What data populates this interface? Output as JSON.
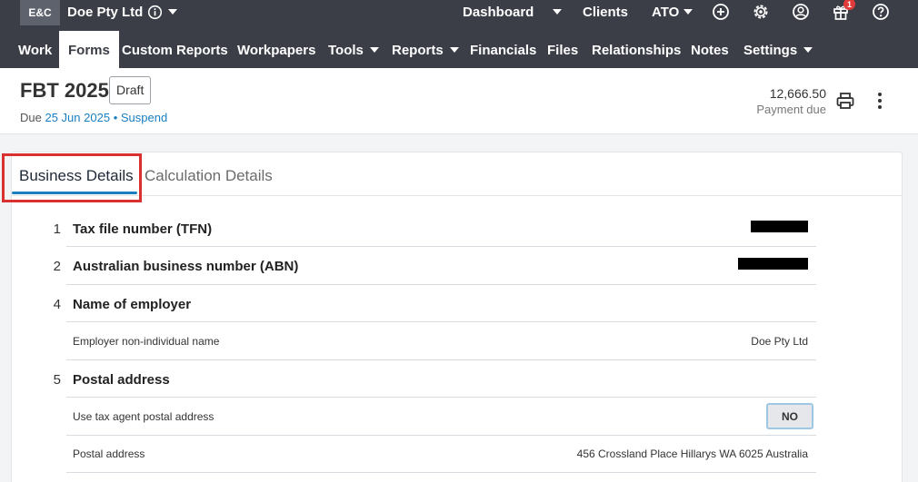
{
  "topbar": {
    "logo_text": "E&C",
    "client_name": "Doe Pty Ltd",
    "dashboard": "Dashboard",
    "clients": "Clients",
    "ato": "ATO",
    "notification_count": "1"
  },
  "nav": {
    "items": [
      "Work",
      "Forms",
      "Custom Reports",
      "Workpapers",
      "Tools",
      "Reports",
      "Financials",
      "Files",
      "Relationships",
      "Notes",
      "Settings"
    ],
    "active": "Forms"
  },
  "header": {
    "title": "FBT 2025",
    "status_badge": "Draft",
    "due_prefix": "Due",
    "due_date": "25 Jun 2025",
    "separator": "•",
    "suspend_link": "Suspend",
    "amount": "12,666.50",
    "amount_label": "Payment due"
  },
  "tabs": {
    "business_details": "Business Details",
    "calculation_details": "Calculation Details",
    "active": "Business Details"
  },
  "form": {
    "rows": [
      {
        "num": "1",
        "label": "Tax file number (TFN)"
      },
      {
        "num": "2",
        "label": "Australian business number (ABN)"
      },
      {
        "num": "4",
        "label": "Name of employer"
      },
      {
        "sublabel": "Employer non-individual name",
        "value": "Doe Pty Ltd"
      },
      {
        "num": "5",
        "label": "Postal address"
      },
      {
        "sublabel": "Use tax agent postal address",
        "toggle": "NO"
      },
      {
        "sublabel": "Postal address",
        "value": "456 Crossland Place Hillarys WA 6025 Australia"
      }
    ]
  },
  "colors": {
    "topbar_bg": "#3b3e47",
    "link_blue": "#1a7fc1",
    "highlight_red": "#d9312f"
  }
}
